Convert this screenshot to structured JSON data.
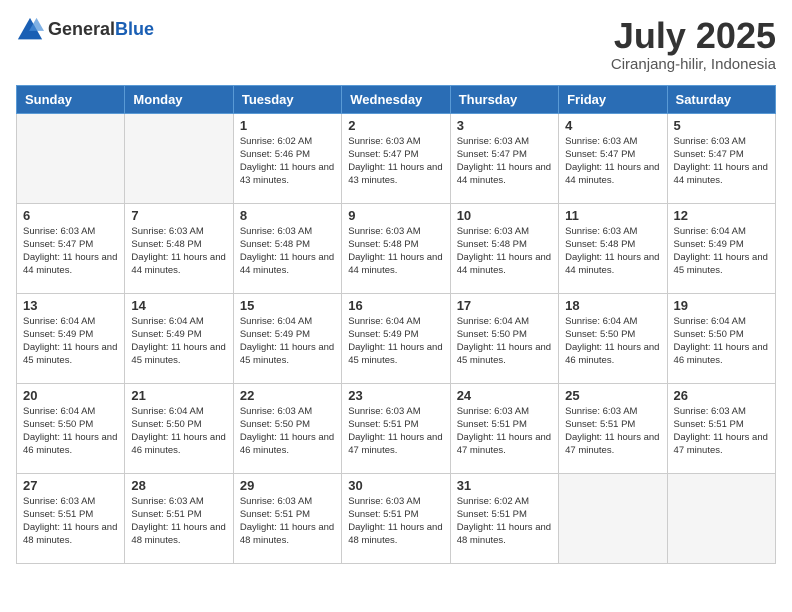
{
  "header": {
    "logo_general": "General",
    "logo_blue": "Blue",
    "month_title": "July 2025",
    "location": "Ciranjang-hilir, Indonesia"
  },
  "calendar": {
    "days_of_week": [
      "Sunday",
      "Monday",
      "Tuesday",
      "Wednesday",
      "Thursday",
      "Friday",
      "Saturday"
    ],
    "weeks": [
      [
        {
          "day": "",
          "empty": true
        },
        {
          "day": "",
          "empty": true
        },
        {
          "day": "1",
          "sunrise": "Sunrise: 6:02 AM",
          "sunset": "Sunset: 5:46 PM",
          "daylight": "Daylight: 11 hours and 43 minutes."
        },
        {
          "day": "2",
          "sunrise": "Sunrise: 6:03 AM",
          "sunset": "Sunset: 5:47 PM",
          "daylight": "Daylight: 11 hours and 43 minutes."
        },
        {
          "day": "3",
          "sunrise": "Sunrise: 6:03 AM",
          "sunset": "Sunset: 5:47 PM",
          "daylight": "Daylight: 11 hours and 44 minutes."
        },
        {
          "day": "4",
          "sunrise": "Sunrise: 6:03 AM",
          "sunset": "Sunset: 5:47 PM",
          "daylight": "Daylight: 11 hours and 44 minutes."
        },
        {
          "day": "5",
          "sunrise": "Sunrise: 6:03 AM",
          "sunset": "Sunset: 5:47 PM",
          "daylight": "Daylight: 11 hours and 44 minutes."
        }
      ],
      [
        {
          "day": "6",
          "sunrise": "Sunrise: 6:03 AM",
          "sunset": "Sunset: 5:47 PM",
          "daylight": "Daylight: 11 hours and 44 minutes."
        },
        {
          "day": "7",
          "sunrise": "Sunrise: 6:03 AM",
          "sunset": "Sunset: 5:48 PM",
          "daylight": "Daylight: 11 hours and 44 minutes."
        },
        {
          "day": "8",
          "sunrise": "Sunrise: 6:03 AM",
          "sunset": "Sunset: 5:48 PM",
          "daylight": "Daylight: 11 hours and 44 minutes."
        },
        {
          "day": "9",
          "sunrise": "Sunrise: 6:03 AM",
          "sunset": "Sunset: 5:48 PM",
          "daylight": "Daylight: 11 hours and 44 minutes."
        },
        {
          "day": "10",
          "sunrise": "Sunrise: 6:03 AM",
          "sunset": "Sunset: 5:48 PM",
          "daylight": "Daylight: 11 hours and 44 minutes."
        },
        {
          "day": "11",
          "sunrise": "Sunrise: 6:03 AM",
          "sunset": "Sunset: 5:48 PM",
          "daylight": "Daylight: 11 hours and 44 minutes."
        },
        {
          "day": "12",
          "sunrise": "Sunrise: 6:04 AM",
          "sunset": "Sunset: 5:49 PM",
          "daylight": "Daylight: 11 hours and 45 minutes."
        }
      ],
      [
        {
          "day": "13",
          "sunrise": "Sunrise: 6:04 AM",
          "sunset": "Sunset: 5:49 PM",
          "daylight": "Daylight: 11 hours and 45 minutes."
        },
        {
          "day": "14",
          "sunrise": "Sunrise: 6:04 AM",
          "sunset": "Sunset: 5:49 PM",
          "daylight": "Daylight: 11 hours and 45 minutes."
        },
        {
          "day": "15",
          "sunrise": "Sunrise: 6:04 AM",
          "sunset": "Sunset: 5:49 PM",
          "daylight": "Daylight: 11 hours and 45 minutes."
        },
        {
          "day": "16",
          "sunrise": "Sunrise: 6:04 AM",
          "sunset": "Sunset: 5:49 PM",
          "daylight": "Daylight: 11 hours and 45 minutes."
        },
        {
          "day": "17",
          "sunrise": "Sunrise: 6:04 AM",
          "sunset": "Sunset: 5:50 PM",
          "daylight": "Daylight: 11 hours and 45 minutes."
        },
        {
          "day": "18",
          "sunrise": "Sunrise: 6:04 AM",
          "sunset": "Sunset: 5:50 PM",
          "daylight": "Daylight: 11 hours and 46 minutes."
        },
        {
          "day": "19",
          "sunrise": "Sunrise: 6:04 AM",
          "sunset": "Sunset: 5:50 PM",
          "daylight": "Daylight: 11 hours and 46 minutes."
        }
      ],
      [
        {
          "day": "20",
          "sunrise": "Sunrise: 6:04 AM",
          "sunset": "Sunset: 5:50 PM",
          "daylight": "Daylight: 11 hours and 46 minutes."
        },
        {
          "day": "21",
          "sunrise": "Sunrise: 6:04 AM",
          "sunset": "Sunset: 5:50 PM",
          "daylight": "Daylight: 11 hours and 46 minutes."
        },
        {
          "day": "22",
          "sunrise": "Sunrise: 6:03 AM",
          "sunset": "Sunset: 5:50 PM",
          "daylight": "Daylight: 11 hours and 46 minutes."
        },
        {
          "day": "23",
          "sunrise": "Sunrise: 6:03 AM",
          "sunset": "Sunset: 5:51 PM",
          "daylight": "Daylight: 11 hours and 47 minutes."
        },
        {
          "day": "24",
          "sunrise": "Sunrise: 6:03 AM",
          "sunset": "Sunset: 5:51 PM",
          "daylight": "Daylight: 11 hours and 47 minutes."
        },
        {
          "day": "25",
          "sunrise": "Sunrise: 6:03 AM",
          "sunset": "Sunset: 5:51 PM",
          "daylight": "Daylight: 11 hours and 47 minutes."
        },
        {
          "day": "26",
          "sunrise": "Sunrise: 6:03 AM",
          "sunset": "Sunset: 5:51 PM",
          "daylight": "Daylight: 11 hours and 47 minutes."
        }
      ],
      [
        {
          "day": "27",
          "sunrise": "Sunrise: 6:03 AM",
          "sunset": "Sunset: 5:51 PM",
          "daylight": "Daylight: 11 hours and 48 minutes."
        },
        {
          "day": "28",
          "sunrise": "Sunrise: 6:03 AM",
          "sunset": "Sunset: 5:51 PM",
          "daylight": "Daylight: 11 hours and 48 minutes."
        },
        {
          "day": "29",
          "sunrise": "Sunrise: 6:03 AM",
          "sunset": "Sunset: 5:51 PM",
          "daylight": "Daylight: 11 hours and 48 minutes."
        },
        {
          "day": "30",
          "sunrise": "Sunrise: 6:03 AM",
          "sunset": "Sunset: 5:51 PM",
          "daylight": "Daylight: 11 hours and 48 minutes."
        },
        {
          "day": "31",
          "sunrise": "Sunrise: 6:02 AM",
          "sunset": "Sunset: 5:51 PM",
          "daylight": "Daylight: 11 hours and 48 minutes."
        },
        {
          "day": "",
          "empty": true
        },
        {
          "day": "",
          "empty": true
        }
      ]
    ]
  }
}
